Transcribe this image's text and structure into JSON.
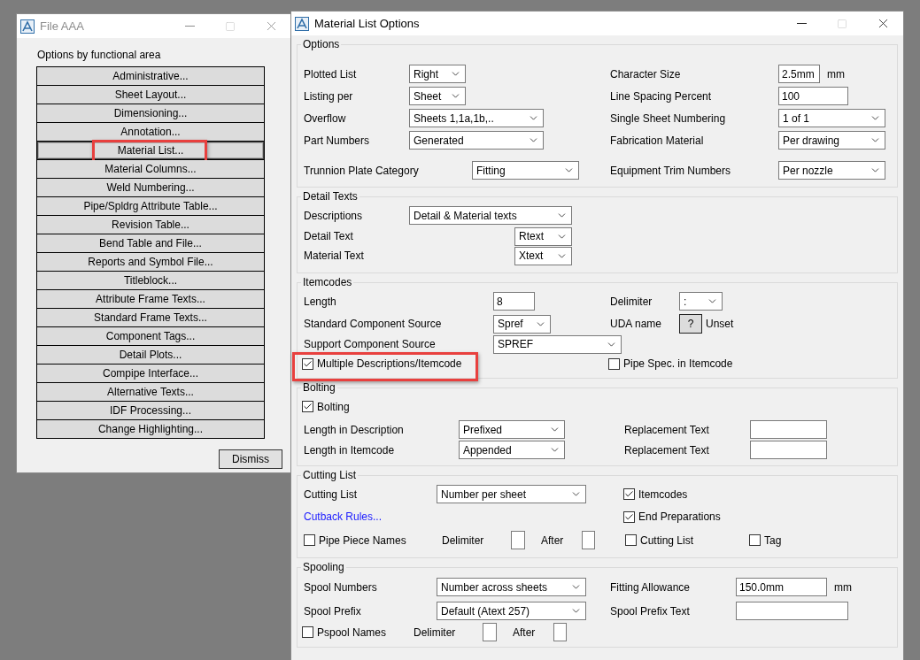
{
  "file_window": {
    "title": "File AAA",
    "heading": "Options by functional area",
    "buttons": [
      {
        "label": "Administrative...",
        "selected": false,
        "highlighted": false
      },
      {
        "label": "Sheet Layout...",
        "selected": false,
        "highlighted": false
      },
      {
        "label": "Dimensioning...",
        "selected": false,
        "highlighted": false
      },
      {
        "label": "Annotation...",
        "selected": false,
        "highlighted": false
      },
      {
        "label": "Material List...",
        "selected": true,
        "highlighted": true
      },
      {
        "label": "Material Columns...",
        "selected": false,
        "highlighted": false
      },
      {
        "label": "Weld Numbering...",
        "selected": false,
        "highlighted": false
      },
      {
        "label": "Pipe/Spldrg Attribute Table...",
        "selected": false,
        "highlighted": false
      },
      {
        "label": "Revision Table...",
        "selected": false,
        "highlighted": false
      },
      {
        "label": "Bend Table and File...",
        "selected": false,
        "highlighted": false
      },
      {
        "label": "Reports and Symbol File...",
        "selected": false,
        "highlighted": false
      },
      {
        "label": "Titleblock...",
        "selected": false,
        "highlighted": false
      },
      {
        "label": "Attribute Frame Texts...",
        "selected": false,
        "highlighted": false
      },
      {
        "label": "Standard Frame Texts...",
        "selected": false,
        "highlighted": false
      },
      {
        "label": "Component Tags...",
        "selected": false,
        "highlighted": false
      },
      {
        "label": "Detail Plots...",
        "selected": false,
        "highlighted": false
      },
      {
        "label": "Compipe Interface...",
        "selected": false,
        "highlighted": false
      },
      {
        "label": "Alternative Texts...",
        "selected": false,
        "highlighted": false
      },
      {
        "label": "IDF Processing...",
        "selected": false,
        "highlighted": false
      },
      {
        "label": "Change Highlighting...",
        "selected": false,
        "highlighted": false
      }
    ],
    "dismiss": "Dismiss"
  },
  "material_window": {
    "title": "Material List Options",
    "groups": [
      {
        "title": "Options",
        "items": [
          {
            "kind": "label",
            "text": "Plotted List"
          },
          {
            "kind": "select",
            "value": "Right"
          },
          {
            "kind": "label",
            "text": "Character Size"
          },
          {
            "kind": "input",
            "value": "2.5mm"
          },
          {
            "kind": "label",
            "text": "mm"
          },
          {
            "kind": "label",
            "text": "Listing per"
          },
          {
            "kind": "select",
            "value": "Sheet"
          },
          {
            "kind": "label",
            "text": "Line Spacing Percent"
          },
          {
            "kind": "input",
            "value": "100"
          },
          {
            "kind": "label",
            "text": "Overflow"
          },
          {
            "kind": "select",
            "value": "Sheets 1,1a,1b,.."
          },
          {
            "kind": "label",
            "text": "Single Sheet Numbering"
          },
          {
            "kind": "select",
            "value": "1 of 1"
          },
          {
            "kind": "label",
            "text": "Part Numbers"
          },
          {
            "kind": "select",
            "value": "Generated"
          },
          {
            "kind": "label",
            "text": "Fabrication Material"
          },
          {
            "kind": "select",
            "value": "Per drawing"
          },
          {
            "kind": "label",
            "text": "Trunnion Plate Category"
          },
          {
            "kind": "select",
            "value": "Fitting"
          },
          {
            "kind": "label",
            "text": "Equipment Trim Numbers"
          },
          {
            "kind": "select",
            "value": "Per nozzle"
          }
        ]
      },
      {
        "title": "Detail Texts",
        "items": [
          {
            "kind": "label",
            "text": "Descriptions"
          },
          {
            "kind": "select",
            "value": "Detail & Material texts"
          },
          {
            "kind": "label",
            "text": "Detail Text"
          },
          {
            "kind": "select",
            "value": "Rtext"
          },
          {
            "kind": "label",
            "text": "Material Text"
          },
          {
            "kind": "select",
            "value": "Xtext"
          }
        ]
      },
      {
        "title": "Itemcodes",
        "items": [
          {
            "kind": "label",
            "text": "Length"
          },
          {
            "kind": "input",
            "value": "8"
          },
          {
            "kind": "label",
            "text": "Delimiter"
          },
          {
            "kind": "select",
            "value": ":"
          },
          {
            "kind": "label",
            "text": "Standard Component Source"
          },
          {
            "kind": "select",
            "value": "Spref"
          },
          {
            "kind": "label",
            "text": "UDA name"
          },
          {
            "kind": "button",
            "text": "?"
          },
          {
            "kind": "label",
            "text": "Unset"
          },
          {
            "kind": "label",
            "text": "Support Component Source"
          },
          {
            "kind": "select",
            "value": "SPREF"
          },
          {
            "kind": "checkbox",
            "label": "Multiple Descriptions/Itemcode",
            "checked": true,
            "highlighted": true
          },
          {
            "kind": "checkbox",
            "label": "Pipe Spec. in Itemcode",
            "checked": false
          }
        ]
      },
      {
        "title": "Bolting",
        "items": [
          {
            "kind": "checkbox",
            "label": "Bolting",
            "checked": true
          },
          {
            "kind": "label",
            "text": "Length in Description"
          },
          {
            "kind": "select",
            "value": "Prefixed"
          },
          {
            "kind": "label",
            "text": "Replacement Text"
          },
          {
            "kind": "input"
          },
          {
            "kind": "label",
            "text": "Length in Itemcode"
          },
          {
            "kind": "select",
            "value": "Appended"
          },
          {
            "kind": "label",
            "text": "Replacement Text"
          },
          {
            "kind": "input"
          }
        ]
      },
      {
        "title": "Cutting List",
        "items": [
          {
            "kind": "label",
            "text": "Cutting List"
          },
          {
            "kind": "select",
            "value": "Number per sheet"
          },
          {
            "kind": "checkbox",
            "label": "Itemcodes",
            "checked": true
          },
          {
            "kind": "link",
            "text": "Cutback Rules..."
          },
          {
            "kind": "checkbox",
            "label": "End Preparations",
            "checked": true
          },
          {
            "kind": "checkbox",
            "label": "Pipe Piece Names",
            "checked": false
          },
          {
            "kind": "label",
            "text": "Delimiter"
          },
          {
            "kind": "input"
          },
          {
            "kind": "label",
            "text": "After"
          },
          {
            "kind": "input"
          },
          {
            "kind": "checkbox",
            "label": "Cutting List",
            "checked": false
          },
          {
            "kind": "checkbox",
            "label": "Tag",
            "checked": false
          }
        ]
      },
      {
        "title": "Spooling",
        "items": [
          {
            "kind": "label",
            "text": "Spool Numbers"
          },
          {
            "kind": "select",
            "value": "Number across sheets"
          },
          {
            "kind": "label",
            "text": "Fitting Allowance"
          },
          {
            "kind": "input",
            "value": "150.0mm"
          },
          {
            "kind": "label",
            "text": "mm"
          },
          {
            "kind": "label",
            "text": "Spool Prefix"
          },
          {
            "kind": "select",
            "value": "Default (Atext 257)"
          },
          {
            "kind": "label",
            "text": "Spool Prefix Text"
          },
          {
            "kind": "input"
          },
          {
            "kind": "checkbox",
            "label": "Pspool Names",
            "checked": false
          },
          {
            "kind": "label",
            "text": "Delimiter"
          },
          {
            "kind": "input"
          },
          {
            "kind": "label",
            "text": "After"
          },
          {
            "kind": "input"
          }
        ]
      }
    ]
  }
}
